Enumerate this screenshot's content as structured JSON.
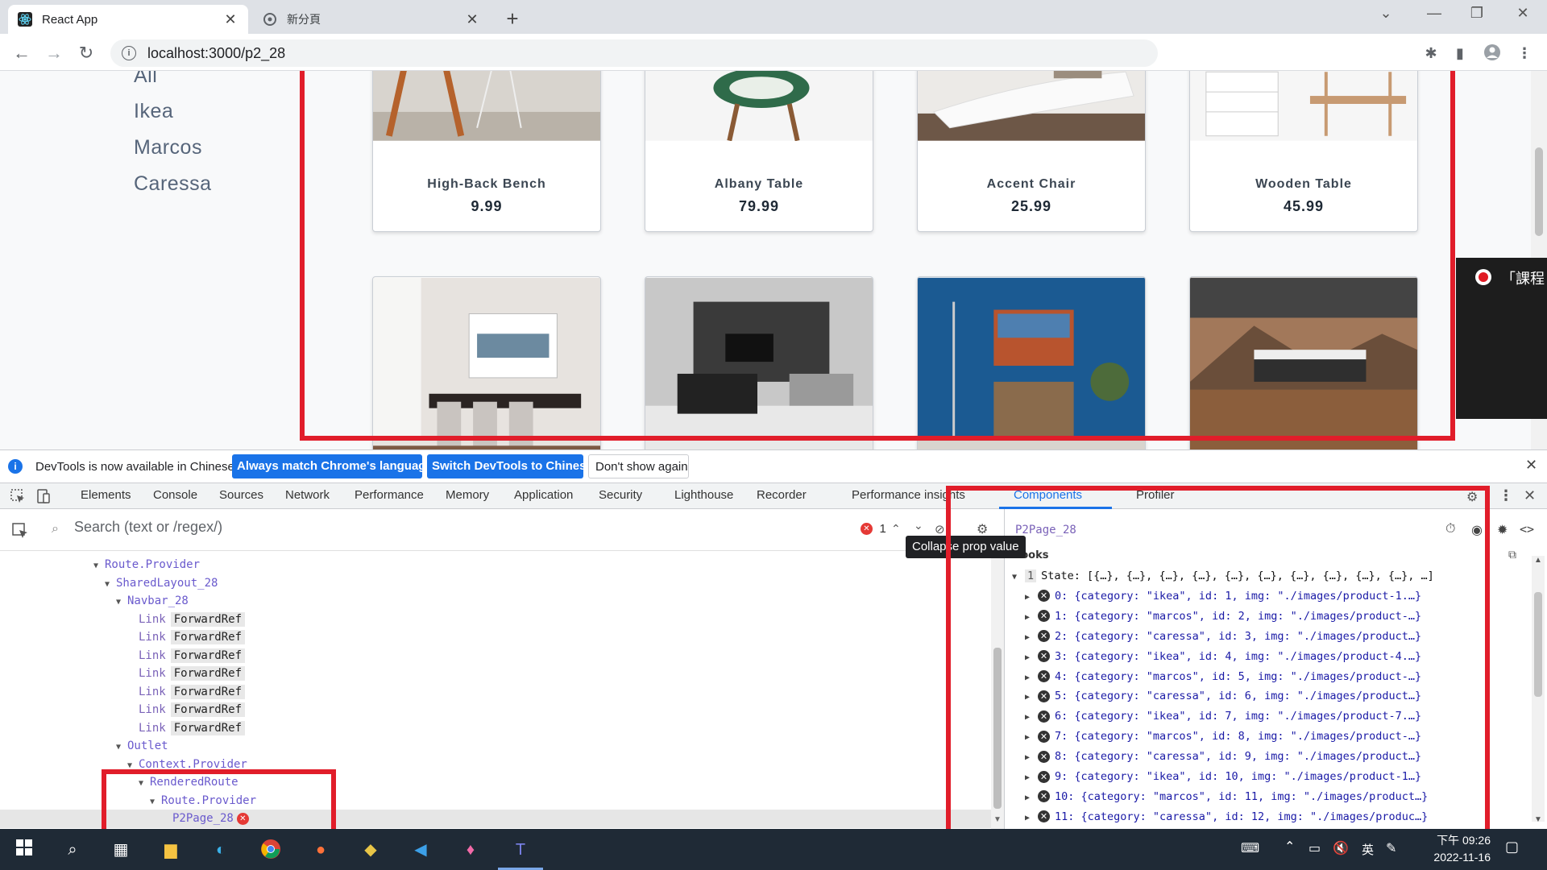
{
  "browser": {
    "tabs": [
      {
        "title": "React App",
        "active": true
      },
      {
        "title": "新分頁",
        "active": false
      }
    ],
    "new_tab": "+",
    "url": "localhost:3000/p2_28"
  },
  "page": {
    "categories": [
      "All",
      "Ikea",
      "Marcos",
      "Caressa"
    ],
    "products_row1": [
      {
        "name": "High-Back Bench",
        "price": "9.99"
      },
      {
        "name": "Albany Table",
        "price": "79.99"
      },
      {
        "name": "Accent Chair",
        "price": "25.99"
      },
      {
        "name": "Wooden Table",
        "price": "45.99"
      }
    ],
    "recorder_text": "「課程"
  },
  "devtools": {
    "infobar": {
      "message": "DevTools is now available in Chinese!",
      "btn1": "Always match Chrome's language",
      "btn2": "Switch DevTools to Chinese",
      "btn3": "Don't show again"
    },
    "tabs": [
      "Elements",
      "Console",
      "Sources",
      "Network",
      "Performance",
      "Memory",
      "Application",
      "Security",
      "Lighthouse",
      "Recorder",
      "Performance insights",
      "Components",
      "Profiler"
    ],
    "search_placeholder": "Search (text or /regex/)",
    "error_count": "1",
    "tooltip": "Collapse prop value",
    "tree": [
      {
        "indent": 0,
        "name": "Route.Provider",
        "expanded": true
      },
      {
        "indent": 1,
        "name": "SharedLayout_28",
        "expanded": true
      },
      {
        "indent": 2,
        "name": "Navbar_28",
        "expanded": true
      },
      {
        "indent": 3,
        "name": "Link",
        "badge": "ForwardRef"
      },
      {
        "indent": 3,
        "name": "Link",
        "badge": "ForwardRef"
      },
      {
        "indent": 3,
        "name": "Link",
        "badge": "ForwardRef"
      },
      {
        "indent": 3,
        "name": "Link",
        "badge": "ForwardRef"
      },
      {
        "indent": 3,
        "name": "Link",
        "badge": "ForwardRef"
      },
      {
        "indent": 3,
        "name": "Link",
        "badge": "ForwardRef"
      },
      {
        "indent": 3,
        "name": "Link",
        "badge": "ForwardRef"
      },
      {
        "indent": 2,
        "name": "Outlet",
        "expanded": true
      },
      {
        "indent": 3,
        "name": "Context.Provider",
        "expanded": true
      },
      {
        "indent": 4,
        "name": "RenderedRoute",
        "expanded": true
      },
      {
        "indent": 5,
        "name": "Route.Provider",
        "expanded": true
      },
      {
        "indent": 6,
        "name": "P2Page_28",
        "error": true,
        "selected": true
      }
    ],
    "component_name": "P2Page_28",
    "hooks_label": "hooks",
    "state_index": "1",
    "state_summary": "State: [{…}, {…}, {…}, {…}, {…}, {…}, {…}, {…}, {…}, {…}, …]",
    "state_items": [
      "0: {category: \"ikea\", id: 1, img: \"./images/product-1.…}",
      "1: {category: \"marcos\", id: 2, img: \"./images/product-…}",
      "2: {category: \"caressa\", id: 3, img: \"./images/product…}",
      "3: {category: \"ikea\", id: 4, img: \"./images/product-4.…}",
      "4: {category: \"marcos\", id: 5, img: \"./images/product-…}",
      "5: {category: \"caressa\", id: 6, img: \"./images/product…}",
      "6: {category: \"ikea\", id: 7, img: \"./images/product-7.…}",
      "7: {category: \"marcos\", id: 8, img: \"./images/product-…}",
      "8: {category: \"caressa\", id: 9, img: \"./images/product…}",
      "9: {category: \"ikea\", id: 10, img: \"./images/product-1…}",
      "10: {category: \"marcos\", id: 11, img: \"./images/product…}",
      "11: {category: \"caressa\", id: 12, img: \"./images/produc…}"
    ]
  },
  "taskbar": {
    "time": "下午 09:26",
    "date": "2022-11-16",
    "ime": "英"
  },
  "colors": {
    "accent": "#1a73e8",
    "annotation_red": "#e11d2a",
    "taskbar": "#1f2a36"
  }
}
